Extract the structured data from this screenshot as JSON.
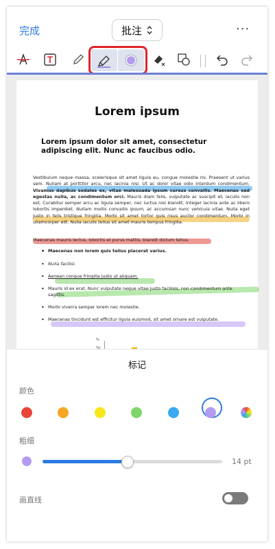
{
  "header": {
    "done_label": "完成",
    "mode_label": "批注",
    "more_label": "···"
  },
  "toolbar": {
    "tools": [
      "strikethrough",
      "textbox",
      "pen",
      "highlighter",
      "color-picker",
      "eraser",
      "shapes",
      "undo",
      "redo"
    ],
    "active_tool": "highlighter"
  },
  "document": {
    "title": "Lorem ipsum",
    "subtitle": "Lorem ipsum dolor sit amet, consectetur adipiscing elit. Nunc ac faucibus odio.",
    "paragraph1_a": "Vestibulum neque massa, scelerisque sit amet ligula eu, congue molestie mi. Praesent ut varius sem. Nullam at porttitor arcu, nec lacinia nisi. Ut ac dolor vitae odio interdum condimentum. ",
    "paragraph1_bold": "Vivamus dapibus sodales ex, vitae malesuada ipsum cursus convallis. Maecenas sed egestas nulla, ac condimentum orci.",
    "paragraph1_b": " Mauris diam felis, vulputate ac suscipit et, iaculis non est. Curabitur semper arcu ac ligula semper, nec luctus nisi blandit. Integer lacinia ante ac libero lobortis imperdiet. ",
    "paragraph1_italic": "Nullam mollis convallis ipsum, ac accumsan nunc vehicula vitae.",
    "paragraph1_c": " Nulla eget justo in felis tristique fringilla. Morbi sit amet tortor quis risus auctor condimentum. Morbi in ullamcorper elit. Nulla iaculis tellus sit amet mauris tempus fringilla.",
    "paragraph2": "Maecenas mauris lectus, lobortis et purus mattis, blandit dictum tellus.",
    "bullets": [
      "Maecenas non lorem quis tellus placerat varius.",
      "Nulla facilisi.",
      "Aenean congue fringilla justo ut aliquam.",
      "Mauris id ex erat. Nunc vulputate neque vitae justo facilisis, non condimentum ante sagittis.",
      "Morbi viverra semper lorem nec molestie.",
      "Maecenas tincidunt est efficitur ligula euismod, sit amet ornare est vulputate."
    ],
    "chart_ticks": [
      "%",
      "%)"
    ]
  },
  "panel": {
    "title": "标记",
    "color_label": "颜色",
    "thickness_label": "粗细",
    "thickness_value": "14 pt",
    "thickness_fraction": 0.47,
    "straight_line_label": "画直线",
    "straight_line_on": false,
    "colors": [
      "#e8453c",
      "#f5a623",
      "#f8e71c",
      "#7ed66a",
      "#36a9f0",
      "#b49bf0",
      "rainbow"
    ],
    "selected_color": "#b49bf0"
  },
  "colors": {
    "accent": "#2a7ae2",
    "tool_highlight_border": "#e0232a"
  }
}
